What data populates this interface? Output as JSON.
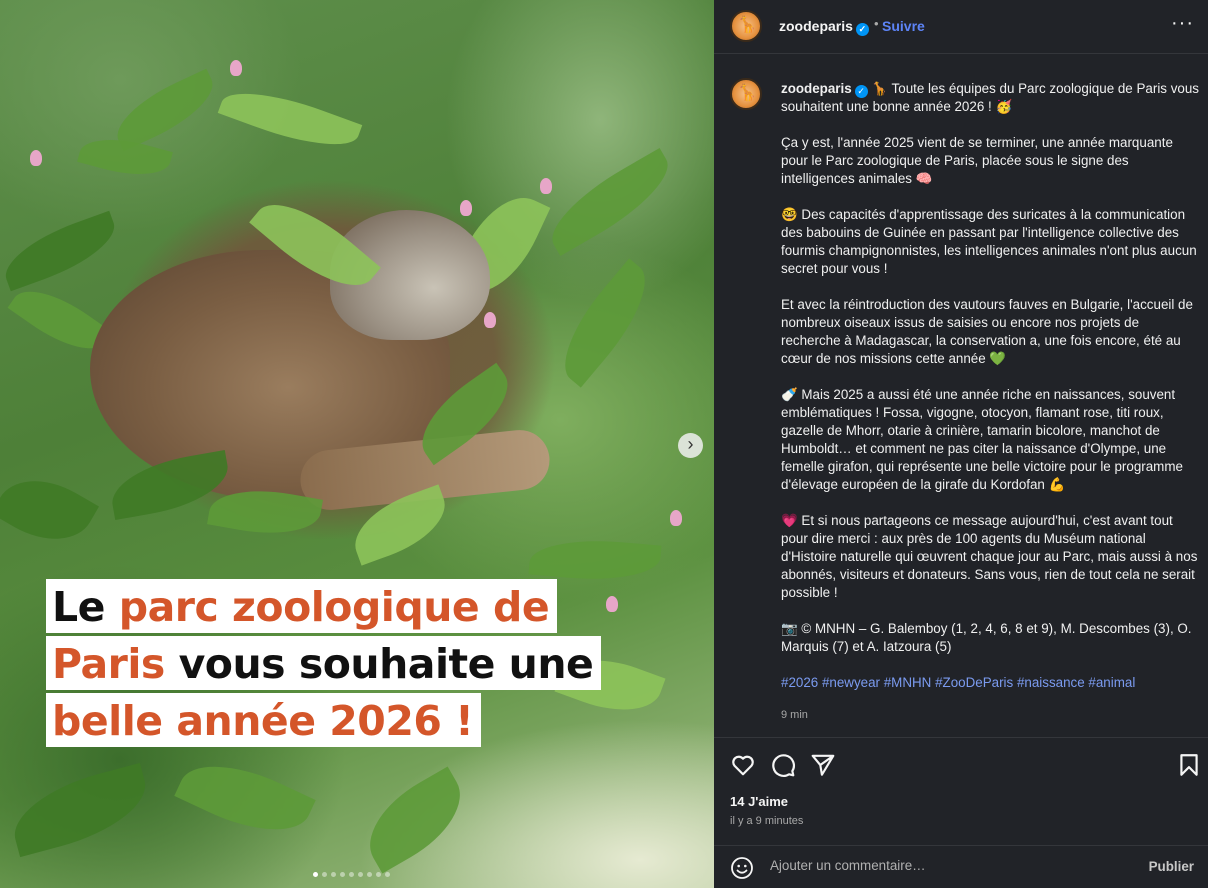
{
  "account": {
    "username": "zoodeparis",
    "verified_badge": "✓",
    "separator": "•",
    "follow_label": "Suivre",
    "more_icon": "···"
  },
  "media": {
    "caption": {
      "line1_dark": "Le ",
      "line1_orange": "parc zoologique de",
      "line2_orange": "Paris",
      "line2_dark": " vous souhaite une",
      "line3_orange": "belle année 2026 !"
    },
    "carousel": {
      "slides": 9,
      "active_index": 0
    }
  },
  "post": {
    "username": "zoodeparis",
    "paragraphs": [
      " 🦒 Toute les équipes du Parc zoologique de Paris vous souhaitent une bonne année 2026 ! 🥳",
      "Ça y est, l'année 2025 vient de se terminer, une année marquante pour le Parc zoologique de Paris, placée sous le signe des intelligences animales 🧠",
      "🤓 Des capacités d'apprentissage des suricates à la communication des babouins de Guinée en passant par l'intelligence collective des fourmis champignonnistes, les intelligences animales n'ont plus aucun secret pour vous !",
      "Et avec la réintroduction des vautours fauves en Bulgarie, l'accueil de nombreux oiseaux issus de saisies ou encore nos projets de recherche à Madagascar, la conservation a, une fois encore, été au cœur de nos missions cette année 💚",
      "🍼 Mais 2025 a aussi été une année riche en naissances, souvent emblématiques ! Fossa, vigogne, otocyon, flamant rose, titi roux, gazelle de Mhorr, otarie à crinière, tamarin bicolore, manchot de Humboldt… et comment ne pas citer la naissance d'Olympe, une femelle girafon, qui représente une belle victoire pour le programme d'élevage européen de la girafe du Kordofan 💪",
      "💗 Et si nous partageons ce message aujourd'hui, c'est avant tout pour dire merci : aux près de 100 agents du Muséum national d'Histoire naturelle qui œuvrent chaque jour au Parc, mais aussi à nos abonnés, visiteurs et donateurs. Sans vous, rien de tout cela ne serait possible !",
      "📷 © MNHN – G. Balemboy (1, 2, 4, 6, 8 et 9), M. Descombes (3), O. Marquis (7) et A. Iatzoura (5)"
    ],
    "hashtags": "#2026 #newyear #MNHN #ZooDeParis #naissance #animal",
    "time_ago": "9 min"
  },
  "actions": {
    "like_icon": "heart-icon",
    "comment_icon": "comment-icon",
    "share_icon": "share-icon",
    "save_icon": "bookmark-icon",
    "likes": "14 J'aime",
    "posted": "il y a 9 minutes"
  },
  "comment_box": {
    "placeholder": "Ajouter un commentaire…",
    "publish_label": "Publier"
  },
  "colors": {
    "panel_bg": "#212328",
    "accent_blue": "#5d84f7",
    "caption_orange": "#d4562a"
  }
}
